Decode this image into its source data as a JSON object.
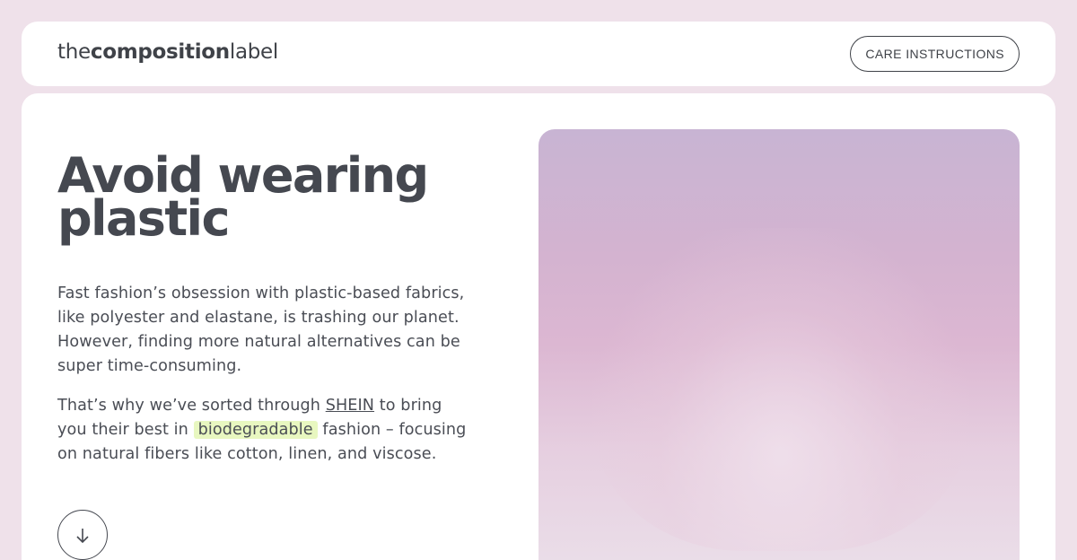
{
  "header": {
    "logo": {
      "prefix": "the",
      "bold": "composition",
      "suffix": "label"
    },
    "care_button_label": "CARE INSTRUCTIONS"
  },
  "hero": {
    "headline": "Avoid wearing plastic",
    "paragraph1": "Fast fashion’s obsession with plastic-based fabrics, like polyester and elastane, is trashing our planet. However, finding more natural alternatives can be super time-consuming.",
    "paragraph2": {
      "before_link": "That’s why we’ve sorted through ",
      "link_text": "SHEIN",
      "after_link": " to bring you their best in ",
      "highlight": "biodegradable",
      "after_highlight": " fashion – focusing on natural fibers like cotton, linen, and viscose."
    },
    "scroll_icon": "arrow-down-icon"
  },
  "colors": {
    "background": "#efe1ea",
    "text": "#454850",
    "highlight": "#e8f7c0"
  }
}
